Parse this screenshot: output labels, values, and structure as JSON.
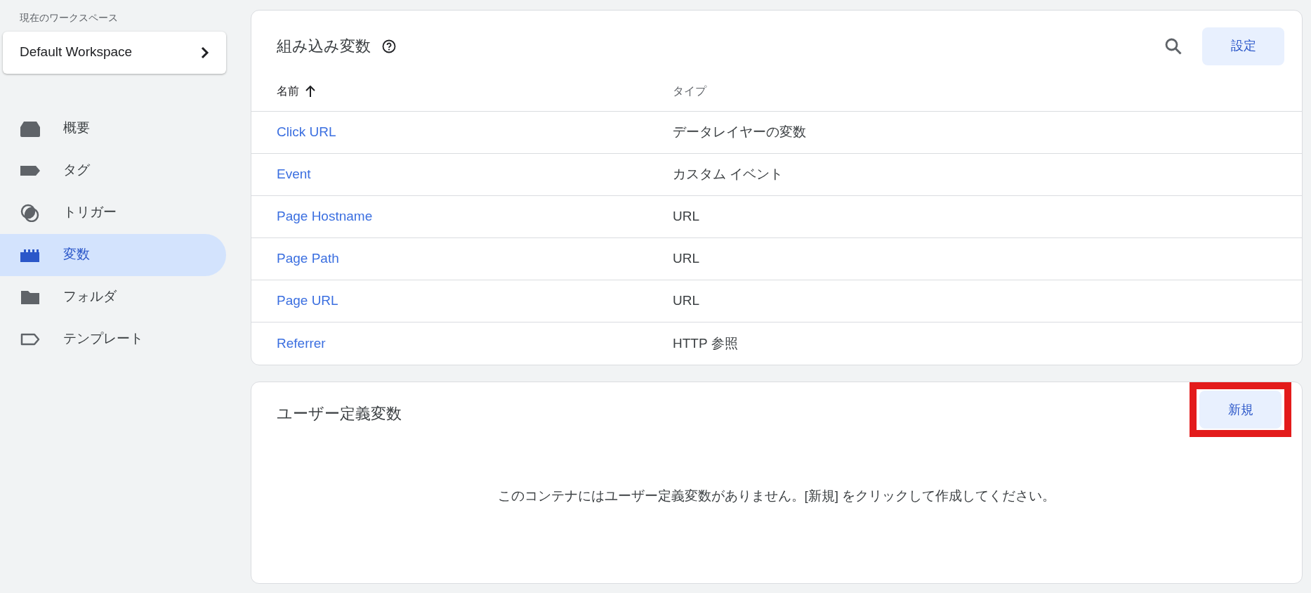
{
  "sidebar": {
    "workspace_label": "現在のワークスペース",
    "workspace": "Default Workspace",
    "items": [
      {
        "label": "概要",
        "kind": "overview",
        "selected": false
      },
      {
        "label": "タグ",
        "kind": "tag",
        "selected": false
      },
      {
        "label": "トリガー",
        "kind": "trigger",
        "selected": false
      },
      {
        "label": "変数",
        "kind": "variable",
        "selected": true
      },
      {
        "label": "フォルダ",
        "kind": "folder",
        "selected": false
      },
      {
        "label": "テンプレート",
        "kind": "template",
        "selected": false
      }
    ]
  },
  "builtin": {
    "title": "組み込み変数",
    "settings_button": "設定",
    "columns": [
      {
        "label": "名前",
        "sorted": true
      },
      {
        "label": "タイプ",
        "sorted": false
      }
    ],
    "rows": [
      {
        "name": "Click URL",
        "type": "データレイヤーの変数"
      },
      {
        "name": "Event",
        "type": "カスタム イベント"
      },
      {
        "name": "Page Hostname",
        "type": "URL"
      },
      {
        "name": "Page Path",
        "type": "URL"
      },
      {
        "name": "Page URL",
        "type": "URL"
      },
      {
        "name": "Referrer",
        "type": "HTTP 参照"
      }
    ]
  },
  "user_defined": {
    "title": "ユーザー定義変数",
    "new_button": "新規",
    "highlighted": true,
    "empty_message": "このコンテナにはユーザー定義変数がありません。[新規] をクリックして作成してください。"
  }
}
